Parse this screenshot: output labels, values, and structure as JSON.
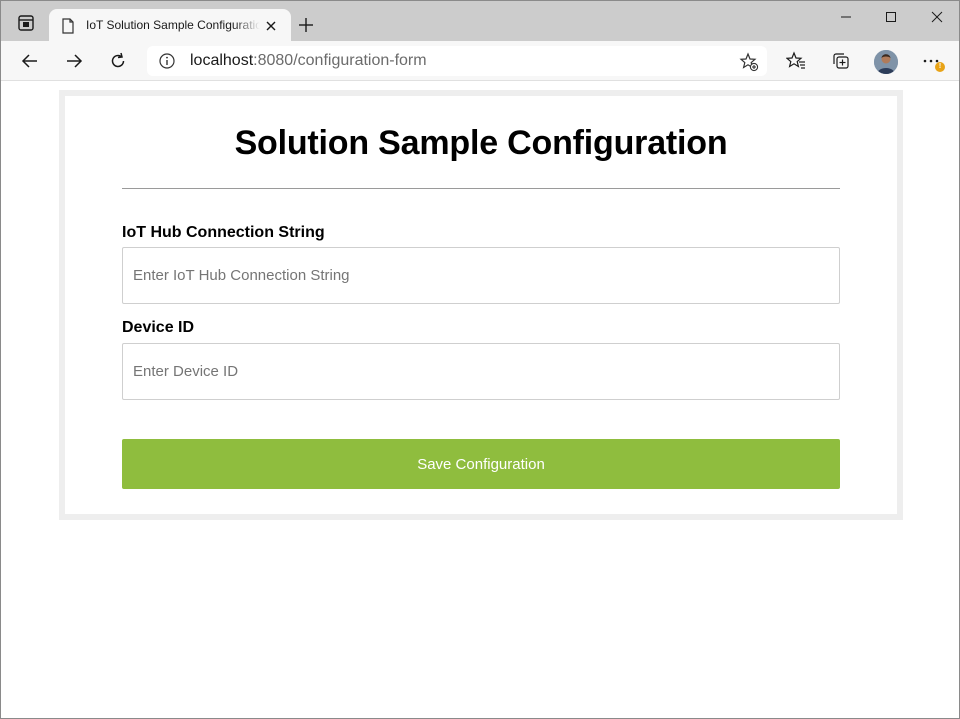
{
  "browser": {
    "tab": {
      "title": "IoT Solution Sample Configuration Form"
    },
    "address": {
      "host": "localhost",
      "rest": ":8080/configuration-form"
    },
    "icons": {
      "tab_actions": "tab-actions-icon",
      "favicon": "page-icon",
      "close_tab": "close-icon",
      "new_tab": "plus-icon",
      "minimize": "minimize-icon",
      "maximize": "maximize-icon",
      "close_window": "close-icon",
      "back": "arrow-left-icon",
      "forward": "arrow-right-icon",
      "refresh": "refresh-icon",
      "site_info": "info-icon",
      "add_favorite": "star-add-icon",
      "favorites": "favorites-icon",
      "collections": "collections-icon",
      "profile": "avatar",
      "more": "more-icon"
    },
    "more_badge": "!"
  },
  "form": {
    "title": "Solution Sample Configuration",
    "fields": [
      {
        "label": "IoT Hub Connection String",
        "placeholder": "Enter IoT Hub Connection String",
        "value": ""
      },
      {
        "label": "Device ID",
        "placeholder": "Enter Device ID",
        "value": ""
      }
    ],
    "submit_label": "Save Configuration"
  },
  "colors": {
    "accent_button": "#8fbd3e",
    "card_border": "#eeeeee",
    "tabstrip": "#cccccc"
  }
}
